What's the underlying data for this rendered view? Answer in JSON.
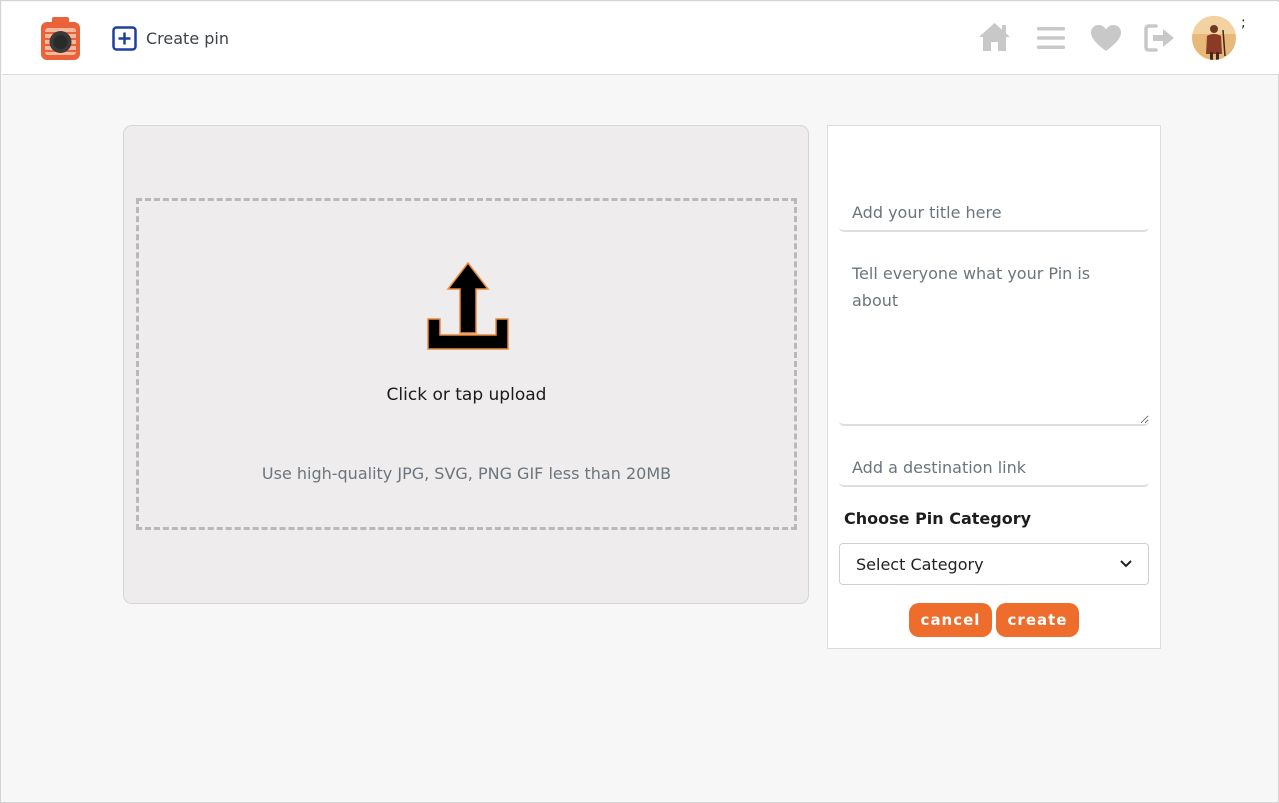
{
  "header": {
    "logo_icon": "camera-logo-icon",
    "create_pin_label": "Create pin",
    "create_pin_icon": "plus-square-icon",
    "nav_icons": [
      "home-icon",
      "menu-icon",
      "heart-icon",
      "logout-icon"
    ],
    "avatar_mark": ";"
  },
  "upload": {
    "icon": "upload-icon",
    "title": "Click or tap upload",
    "hint": "Use high-quality JPG, SVG, PNG GIF less than 20MB"
  },
  "form": {
    "title_placeholder": "Add your title here",
    "description_placeholder": "Tell everyone what your Pin is about",
    "link_placeholder": "Add a destination link",
    "category_label": "Choose Pin Category",
    "category_selected": "Select Category",
    "cancel_label": "cancel",
    "create_label": "create"
  },
  "colors": {
    "accent": "#ee6c2c",
    "link_blue": "#1d3fa0",
    "nav_icon_gray": "#c8c8c8"
  }
}
